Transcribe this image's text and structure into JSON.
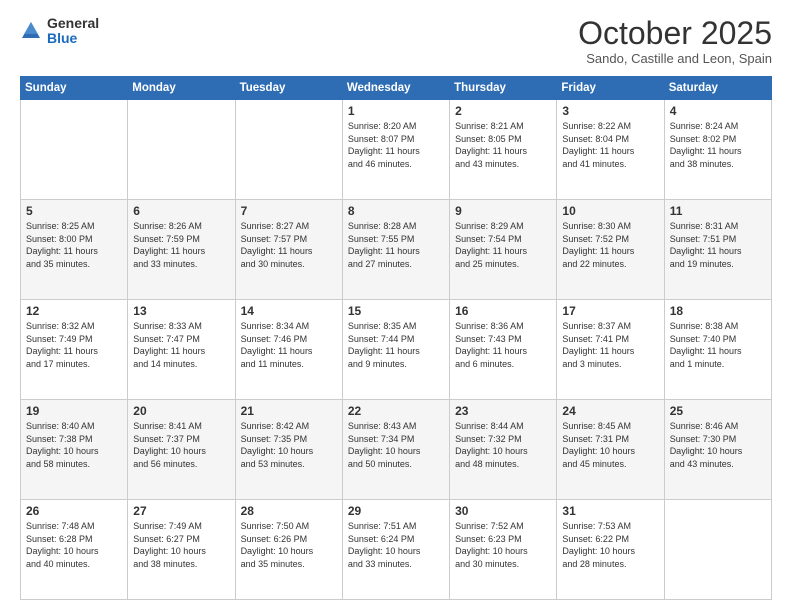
{
  "logo": {
    "general": "General",
    "blue": "Blue"
  },
  "header": {
    "month": "October 2025",
    "location": "Sando, Castille and Leon, Spain"
  },
  "weekdays": [
    "Sunday",
    "Monday",
    "Tuesday",
    "Wednesday",
    "Thursday",
    "Friday",
    "Saturday"
  ],
  "weeks": [
    [
      {
        "day": "",
        "info": ""
      },
      {
        "day": "",
        "info": ""
      },
      {
        "day": "",
        "info": ""
      },
      {
        "day": "1",
        "info": "Sunrise: 8:20 AM\nSunset: 8:07 PM\nDaylight: 11 hours\nand 46 minutes."
      },
      {
        "day": "2",
        "info": "Sunrise: 8:21 AM\nSunset: 8:05 PM\nDaylight: 11 hours\nand 43 minutes."
      },
      {
        "day": "3",
        "info": "Sunrise: 8:22 AM\nSunset: 8:04 PM\nDaylight: 11 hours\nand 41 minutes."
      },
      {
        "day": "4",
        "info": "Sunrise: 8:24 AM\nSunset: 8:02 PM\nDaylight: 11 hours\nand 38 minutes."
      }
    ],
    [
      {
        "day": "5",
        "info": "Sunrise: 8:25 AM\nSunset: 8:00 PM\nDaylight: 11 hours\nand 35 minutes."
      },
      {
        "day": "6",
        "info": "Sunrise: 8:26 AM\nSunset: 7:59 PM\nDaylight: 11 hours\nand 33 minutes."
      },
      {
        "day": "7",
        "info": "Sunrise: 8:27 AM\nSunset: 7:57 PM\nDaylight: 11 hours\nand 30 minutes."
      },
      {
        "day": "8",
        "info": "Sunrise: 8:28 AM\nSunset: 7:55 PM\nDaylight: 11 hours\nand 27 minutes."
      },
      {
        "day": "9",
        "info": "Sunrise: 8:29 AM\nSunset: 7:54 PM\nDaylight: 11 hours\nand 25 minutes."
      },
      {
        "day": "10",
        "info": "Sunrise: 8:30 AM\nSunset: 7:52 PM\nDaylight: 11 hours\nand 22 minutes."
      },
      {
        "day": "11",
        "info": "Sunrise: 8:31 AM\nSunset: 7:51 PM\nDaylight: 11 hours\nand 19 minutes."
      }
    ],
    [
      {
        "day": "12",
        "info": "Sunrise: 8:32 AM\nSunset: 7:49 PM\nDaylight: 11 hours\nand 17 minutes."
      },
      {
        "day": "13",
        "info": "Sunrise: 8:33 AM\nSunset: 7:47 PM\nDaylight: 11 hours\nand 14 minutes."
      },
      {
        "day": "14",
        "info": "Sunrise: 8:34 AM\nSunset: 7:46 PM\nDaylight: 11 hours\nand 11 minutes."
      },
      {
        "day": "15",
        "info": "Sunrise: 8:35 AM\nSunset: 7:44 PM\nDaylight: 11 hours\nand 9 minutes."
      },
      {
        "day": "16",
        "info": "Sunrise: 8:36 AM\nSunset: 7:43 PM\nDaylight: 11 hours\nand 6 minutes."
      },
      {
        "day": "17",
        "info": "Sunrise: 8:37 AM\nSunset: 7:41 PM\nDaylight: 11 hours\nand 3 minutes."
      },
      {
        "day": "18",
        "info": "Sunrise: 8:38 AM\nSunset: 7:40 PM\nDaylight: 11 hours\nand 1 minute."
      }
    ],
    [
      {
        "day": "19",
        "info": "Sunrise: 8:40 AM\nSunset: 7:38 PM\nDaylight: 10 hours\nand 58 minutes."
      },
      {
        "day": "20",
        "info": "Sunrise: 8:41 AM\nSunset: 7:37 PM\nDaylight: 10 hours\nand 56 minutes."
      },
      {
        "day": "21",
        "info": "Sunrise: 8:42 AM\nSunset: 7:35 PM\nDaylight: 10 hours\nand 53 minutes."
      },
      {
        "day": "22",
        "info": "Sunrise: 8:43 AM\nSunset: 7:34 PM\nDaylight: 10 hours\nand 50 minutes."
      },
      {
        "day": "23",
        "info": "Sunrise: 8:44 AM\nSunset: 7:32 PM\nDaylight: 10 hours\nand 48 minutes."
      },
      {
        "day": "24",
        "info": "Sunrise: 8:45 AM\nSunset: 7:31 PM\nDaylight: 10 hours\nand 45 minutes."
      },
      {
        "day": "25",
        "info": "Sunrise: 8:46 AM\nSunset: 7:30 PM\nDaylight: 10 hours\nand 43 minutes."
      }
    ],
    [
      {
        "day": "26",
        "info": "Sunrise: 7:48 AM\nSunset: 6:28 PM\nDaylight: 10 hours\nand 40 minutes."
      },
      {
        "day": "27",
        "info": "Sunrise: 7:49 AM\nSunset: 6:27 PM\nDaylight: 10 hours\nand 38 minutes."
      },
      {
        "day": "28",
        "info": "Sunrise: 7:50 AM\nSunset: 6:26 PM\nDaylight: 10 hours\nand 35 minutes."
      },
      {
        "day": "29",
        "info": "Sunrise: 7:51 AM\nSunset: 6:24 PM\nDaylight: 10 hours\nand 33 minutes."
      },
      {
        "day": "30",
        "info": "Sunrise: 7:52 AM\nSunset: 6:23 PM\nDaylight: 10 hours\nand 30 minutes."
      },
      {
        "day": "31",
        "info": "Sunrise: 7:53 AM\nSunset: 6:22 PM\nDaylight: 10 hours\nand 28 minutes."
      },
      {
        "day": "",
        "info": ""
      }
    ]
  ]
}
